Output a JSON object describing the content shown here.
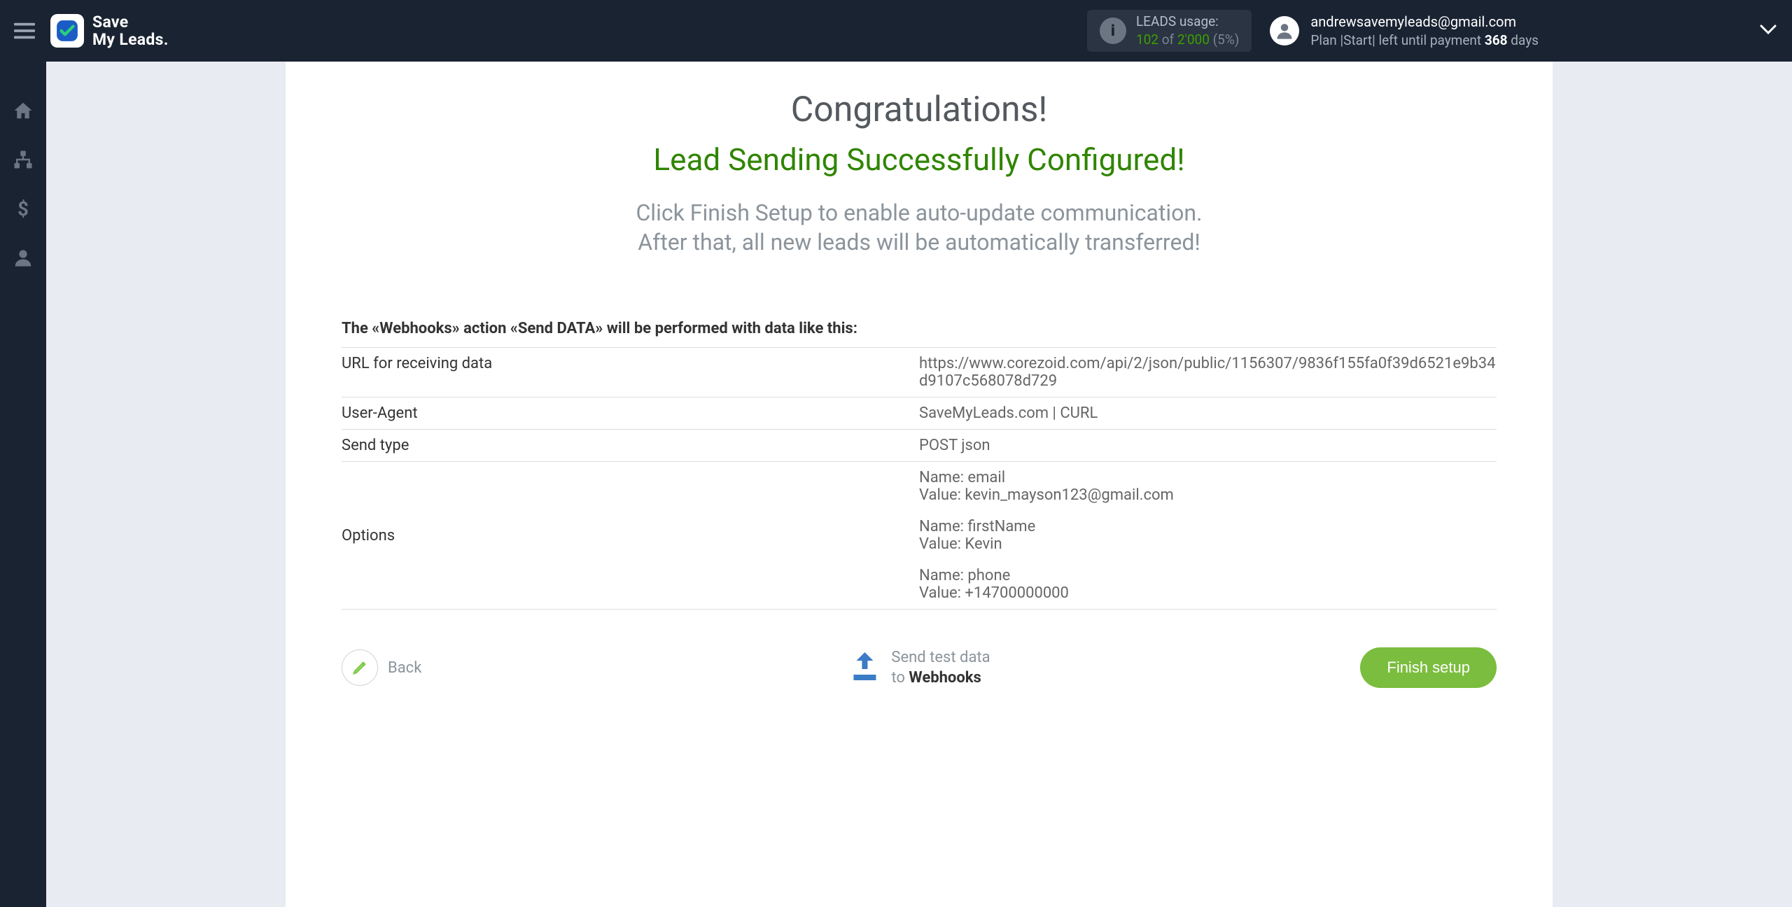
{
  "header": {
    "logo_text": "Save\nMy Leads.",
    "usage": {
      "label": "LEADS usage:",
      "current": "102",
      "of_text": "of",
      "max": "2'000",
      "pct": "(5%)"
    },
    "account": {
      "email": "andrewsavemyleads@gmail.com",
      "plan_prefix": "Plan |",
      "plan_name": "Start",
      "plan_suffix": "| left until payment",
      "days": "368",
      "days_label": "days"
    }
  },
  "main": {
    "title1": "Congratulations!",
    "title2": "Lead Sending Successfully Configured!",
    "subtitle_line1": "Click Finish Setup to enable auto-update communication.",
    "subtitle_line2": "After that, all new leads will be automatically transferred!",
    "section_head": "The «Webhooks» action «Send DATA» will be performed with data like this:",
    "rows": {
      "url": {
        "label": "URL for receiving data",
        "value": "https://www.corezoid.com/api/2/json/public/1156307/9836f155fa0f39d6521e9b34d9107c568078d729"
      },
      "ua": {
        "label": "User-Agent",
        "value": "SaveMyLeads.com | CURL"
      },
      "sendtype": {
        "label": "Send type",
        "value": "POST json"
      },
      "options": {
        "label": "Options",
        "pairs": [
          {
            "name_label": "Name:",
            "name": "email",
            "value_label": "Value:",
            "value": "kevin_mayson123@gmail.com"
          },
          {
            "name_label": "Name:",
            "name": "firstName",
            "value_label": "Value:",
            "value": "Kevin"
          },
          {
            "name_label": "Name:",
            "name": "phone",
            "value_label": "Value:",
            "value": "+14700000000"
          }
        ]
      }
    },
    "footer": {
      "back": "Back",
      "test_line1": "Send test data",
      "test_line2_prefix": "to",
      "test_line2_dest": "Webhooks",
      "finish": "Finish setup"
    }
  }
}
